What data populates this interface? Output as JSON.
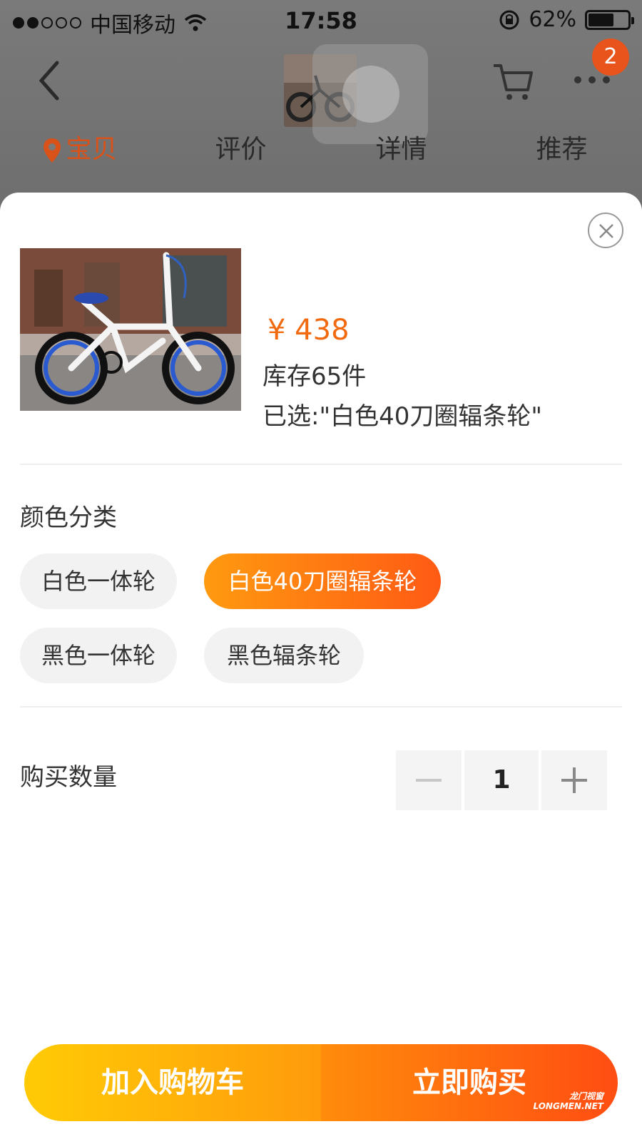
{
  "status_bar": {
    "carrier": "中国移动",
    "time": "17:58",
    "battery_percent": "62%",
    "battery_level": 0.62
  },
  "nav": {
    "cart_badge": "2",
    "tabs": [
      {
        "label": "宝贝",
        "active": true
      },
      {
        "label": "评价",
        "active": false
      },
      {
        "label": "详情",
        "active": false
      },
      {
        "label": "推荐",
        "active": false
      }
    ]
  },
  "sku": {
    "price": "¥ 438",
    "stock": "库存65件",
    "selected": "已选:\"白色40刀圈辐条轮\"",
    "color_title": "颜色分类",
    "options": [
      {
        "label": "白色一体轮",
        "active": false
      },
      {
        "label": "白色40刀圈辐条轮",
        "active": true
      },
      {
        "label": "黑色一体轮",
        "active": false
      },
      {
        "label": "黑色辐条轮",
        "active": false
      }
    ],
    "quantity_title": "购买数量",
    "quantity": "1"
  },
  "actions": {
    "add_to_cart": "加入购物车",
    "buy_now": "立即购买"
  },
  "watermark": {
    "line1": "龙门视窗",
    "line2": "LONGMEN.NET"
  },
  "colors": {
    "accent": "#f26a10",
    "chip_active_start": "#ff9a10",
    "chip_active_end": "#ff5a14",
    "cart_btn_start": "#ffcb05",
    "buy_btn_end": "#ff4d12"
  }
}
